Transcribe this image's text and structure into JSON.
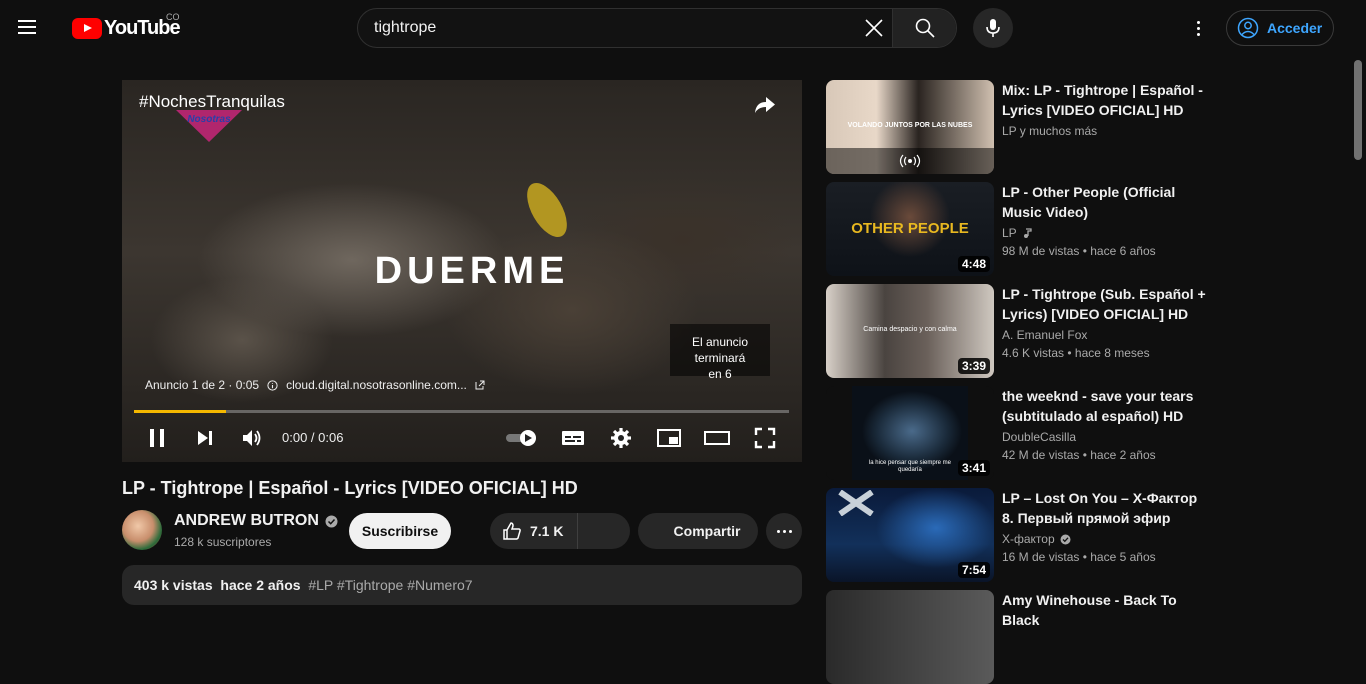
{
  "header": {
    "logo_text": "YouTube",
    "country_code": "CO",
    "search_value": "tightrope",
    "signin_label": "Acceder"
  },
  "player": {
    "ad_hashtag": "#NochesTranquilas",
    "ad_headline": "DUERME",
    "skip_text_line1": "El anuncio terminará",
    "skip_text_line2": "en 6",
    "ad_counter": "Anuncio 1 de 2 · 0:05",
    "ad_url": "cloud.digital.nosotrasonline.com...",
    "brand_badge": "Nosotras",
    "time": "0:00 / 0:06",
    "progress_fraction": 0.14,
    "progress_color": "#f5b800"
  },
  "video": {
    "title": "LP - Tightrope | Español - Lyrics [VIDEO OFICIAL] HD",
    "channel": "ANDREW BUTRON",
    "subscribers": "128 k suscriptores",
    "subscribe_label": "Suscribirse",
    "likes": "7.1 K",
    "share_label": "Compartir",
    "views": "403 k vistas",
    "age": "hace 2 años",
    "tags": "#LP #Tightrope #Numero7"
  },
  "recommendations": [
    {
      "title": "Mix: LP - Tightrope | Español - Lyrics [VIDEO OFICIAL] HD",
      "channel": "LP y muchos más",
      "meta": "",
      "duration": "",
      "thumb_caption": "VOLANDO JUNTOS POR LAS NUBES"
    },
    {
      "title": "LP - Other People (Official Music Video)",
      "channel": "LP",
      "meta": "98 M de vistas  • hace 6 años",
      "duration": "4:48",
      "thumb_caption": "OTHER PEOPLE"
    },
    {
      "title": "LP - Tightrope (Sub. Español + Lyrics) [VIDEO OFICIAL] HD",
      "channel": "A. Emanuel Fox",
      "meta": "4.6 K vistas  • hace 8 meses",
      "duration": "3:39",
      "thumb_caption": "Camina despacio y con calma"
    },
    {
      "title": "the weeknd - save your tears (subtitulado al español) HD",
      "channel": "DoubleCasilla",
      "meta": "42 M de vistas  • hace 2 años",
      "duration": "3:41",
      "thumb_caption": "la hice pensar que siempre me quedaría"
    },
    {
      "title": "LP – Lost On You – X-Фактор 8. Первый прямой эфир",
      "channel": "X-фактор",
      "meta": "16 M de vistas  • hace 5 años",
      "duration": "7:54",
      "thumb_caption": ""
    },
    {
      "title": "Amy Winehouse - Back To Black",
      "channel": "",
      "meta": "",
      "duration": "",
      "thumb_caption": ""
    }
  ]
}
